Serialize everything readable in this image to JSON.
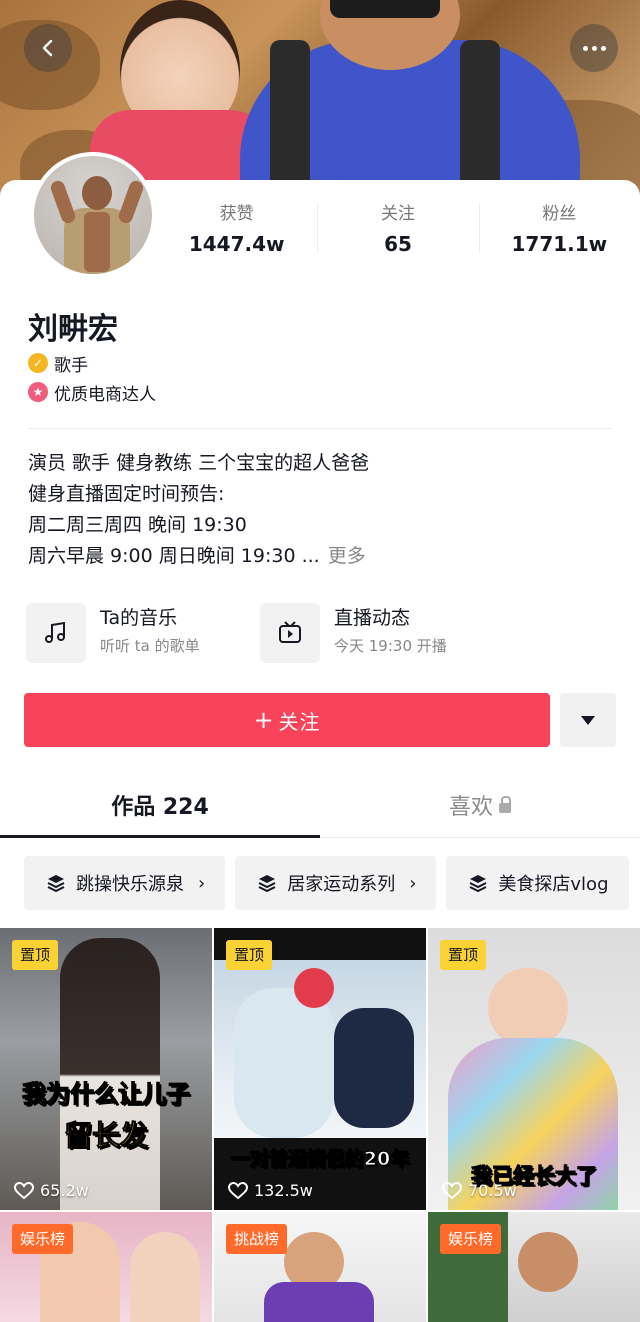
{
  "profile": {
    "name": "刘畊宏",
    "tags": [
      {
        "label": "歌手",
        "icon": "verified-icon"
      },
      {
        "label": "优质电商达人",
        "icon": "star-badge-icon"
      }
    ],
    "stats": [
      {
        "label": "获赞",
        "value": "1447.4w"
      },
      {
        "label": "关注",
        "value": "65"
      },
      {
        "label": "粉丝",
        "value": "1771.1w"
      }
    ],
    "bio_lines": [
      "演员 歌手 健身教练 三个宝宝的超人爸爸",
      "健身直播固定时间预告:",
      "周二周三周四 晚间 19:30",
      "周六早晨 9:00 周日晚间 19:30 ..."
    ],
    "bio_more": "更多"
  },
  "features": [
    {
      "title": "Ta的音乐",
      "sub": "听听 ta 的歌单",
      "icon": "music-note-icon"
    },
    {
      "title": "直播动态",
      "sub": "今天 19:30 开播",
      "icon": "live-tv-icon"
    }
  ],
  "actions": {
    "follow_plus": "+",
    "follow_label": "关注"
  },
  "tabs": [
    {
      "label": "作品 224",
      "active": true
    },
    {
      "label": "喜欢",
      "active": false
    }
  ],
  "collections": [
    {
      "label": "跳操快乐源泉"
    },
    {
      "label": "居家运动系列"
    },
    {
      "label": "美食探店vlog"
    }
  ],
  "videos": [
    {
      "badge": "置顶",
      "caption_line1": "我为什么让儿子",
      "caption_line2": "留长发",
      "likes": "65.2w"
    },
    {
      "badge": "置顶",
      "caption_line1": "一对普通情侣的20年",
      "likes": "132.5w"
    },
    {
      "badge": "置顶",
      "caption_line1": "我已经长大了",
      "likes": "70.5w"
    },
    {
      "badge": "娱乐榜"
    },
    {
      "badge": "挑战榜"
    },
    {
      "badge": "娱乐榜"
    }
  ],
  "colors": {
    "accent": "#f9435a",
    "pin_badge": "#fbd233",
    "rank_badge": "#ff6a2b"
  }
}
